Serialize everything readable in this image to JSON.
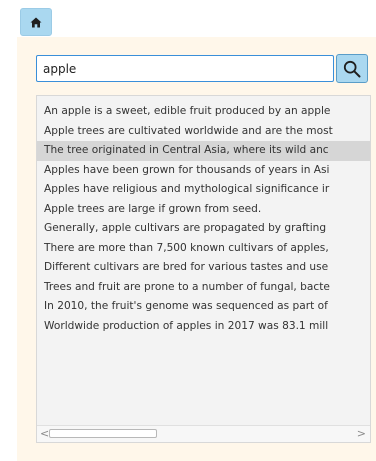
{
  "search": {
    "value": "apple"
  },
  "results": {
    "selected_index": 2,
    "items": [
      "An apple is a sweet, edible fruit produced by an apple",
      "Apple trees are cultivated worldwide and are the most",
      "The tree originated in Central Asia, where its wild anc",
      "Apples have been grown for thousands of years in Asi",
      "Apples have religious and mythological significance ir",
      "Apple trees are large if grown from seed.",
      "Generally, apple cultivars are propagated by grafting",
      "There are more than 7,500 known cultivars of apples,",
      "Different cultivars are bred for various tastes and use",
      "Trees and fruit are prone to a number of fungal, bacte",
      "In 2010, the fruit's genome was sequenced as part of",
      "Worldwide production of apples in 2017 was 83.1 mill"
    ]
  },
  "scrollbar": {
    "left_arrow": "<",
    "right_arrow": ">"
  },
  "icons": {
    "home": "home-icon",
    "search": "search-icon"
  },
  "colors": {
    "panel_background": "#fff7ea",
    "button_background": "#aad8f0",
    "input_border": "#3a8fd9",
    "selected_row": "#d6d6d6"
  }
}
